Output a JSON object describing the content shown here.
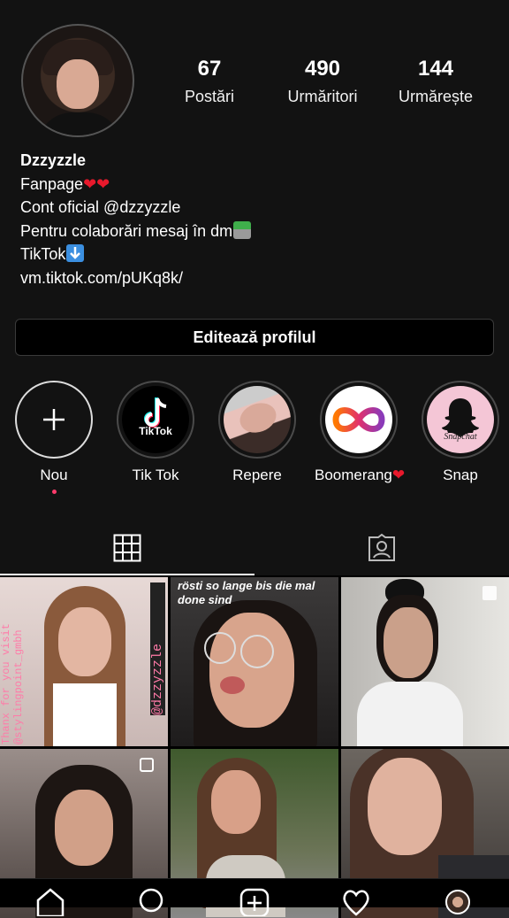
{
  "profile": {
    "stats": [
      {
        "value": "67",
        "label": "Postări"
      },
      {
        "value": "490",
        "label": "Urmăritori"
      },
      {
        "value": "144",
        "label": "Urmărește"
      }
    ],
    "bio": {
      "name": "Dzzyzzle",
      "line1": "Fanpage",
      "line1_hearts": "❤❤",
      "line2": "Cont oficial @dzzyzzle",
      "line3": "Pentru colaborări mesaj în dm",
      "line4": "TikTok",
      "link": "vm.tiktok.com/pUKq8k/"
    },
    "edit_button": "Editează profilul"
  },
  "highlights": [
    {
      "label": "Nou"
    },
    {
      "label": "Tik Tok",
      "badge_text": "TikTok"
    },
    {
      "label": "Repere"
    },
    {
      "label": "Boomerang",
      "label_heart": "❤"
    },
    {
      "label": "Snap",
      "badge_text": "Snapchat"
    }
  ],
  "grid": {
    "tile1_vertical_left": "Thanx for you visit @stylingpoint_gmbh",
    "tile1_vertical_right": "@dzzyzzle",
    "tile2_caption": "rösti so lange bis die mal done sind"
  },
  "icons": {
    "grid_tab": "grid-icon",
    "tagged_tab": "tagged-person-icon",
    "home": "home-icon",
    "search": "search-icon",
    "add": "add-post-icon",
    "activity": "heart-icon",
    "profile": "profile-avatar"
  },
  "colors": {
    "background": "#121212",
    "heart": "#e8192c",
    "story_dot": "#ff3b6b"
  }
}
